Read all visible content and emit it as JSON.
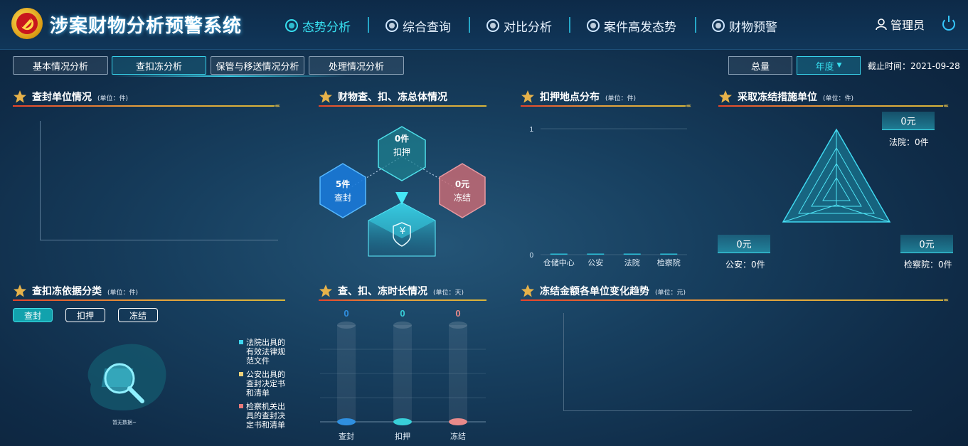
{
  "header": {
    "title": "涉案财物分析预警系统",
    "nav": [
      {
        "label": "态势分析",
        "active": true,
        "icon": "dashboard-icon"
      },
      {
        "label": "综合查询",
        "active": false,
        "icon": "search-icon"
      },
      {
        "label": "对比分析",
        "active": false,
        "icon": "compare-icon"
      },
      {
        "label": "案件高发态势",
        "active": false,
        "icon": "trend-icon"
      },
      {
        "label": "财物预警",
        "active": false,
        "icon": "alarm-icon"
      }
    ],
    "user": "管理员"
  },
  "tabs": [
    {
      "label": "基本情况分析",
      "active": false
    },
    {
      "label": "查扣冻分析",
      "active": true
    },
    {
      "label": "保管与移送情况分析",
      "active": false
    },
    {
      "label": "处理情况分析",
      "active": false
    }
  ],
  "filters": {
    "total_label": "总量",
    "year_label": "年度",
    "deadline": "截止时间：2021-09-28"
  },
  "sections": {
    "unit_seal": {
      "title": "查封单位情况",
      "unit": "(单位：件)"
    },
    "overall": {
      "title": "财物查、扣、冻总体情况"
    },
    "location": {
      "title": "扣押地点分布",
      "unit": "(单位：件)"
    },
    "freeze_unit": {
      "title": "采取冻结措施单位",
      "unit": "(单位：件)"
    },
    "basis": {
      "title": "查扣冻依据分类",
      "unit": "(单位：件)"
    },
    "duration": {
      "title": "查、扣、冻时长情况",
      "unit": "(单位：天)"
    },
    "trend": {
      "title": "冻结金额各单位变化趋势",
      "unit": "(单位：元)"
    }
  },
  "overall": {
    "seize": {
      "value": "0件",
      "label": "扣押"
    },
    "seal": {
      "value": "5件",
      "label": "查封"
    },
    "freeze": {
      "value": "0元",
      "label": "冻结"
    },
    "currency_symbol": "¥"
  },
  "freeze_unit": {
    "court": {
      "value": "0元",
      "label": "法院：0件"
    },
    "police": {
      "value": "0元",
      "label": "公安：0件"
    },
    "procuratorate": {
      "value": "0元",
      "label": "检察院：0件"
    }
  },
  "basis": {
    "pills": [
      {
        "label": "查封",
        "active": true
      },
      {
        "label": "扣押",
        "active": false
      },
      {
        "label": "冻结",
        "active": false
      }
    ],
    "empty_text": "暂无数据~",
    "legend": [
      {
        "label": "法院出具的有效法律规范文件",
        "color": "#3fd6f0"
      },
      {
        "label": "公安出具的查封决定书和清单",
        "color": "#f0d27a"
      },
      {
        "label": "检察机关出具的查封决定书和清单",
        "color": "#e87a7a"
      }
    ]
  },
  "chart_data": [
    {
      "type": "bar",
      "title": "扣押地点分布",
      "categories": [
        "仓储中心",
        "公安",
        "法院",
        "检察院"
      ],
      "values": [
        0,
        0,
        0,
        0
      ],
      "ylim": [
        0,
        1
      ],
      "yticks": [
        "0",
        "1"
      ]
    },
    {
      "type": "bar",
      "title": "查、扣、冻时长情况",
      "categories": [
        "查封",
        "扣押",
        "冻结"
      ],
      "values": [
        0,
        0,
        0
      ],
      "data_labels": [
        "0",
        "0",
        "0"
      ],
      "colors": [
        "#2f8fe0",
        "#38cfd8",
        "#e88a8a"
      ]
    }
  ]
}
